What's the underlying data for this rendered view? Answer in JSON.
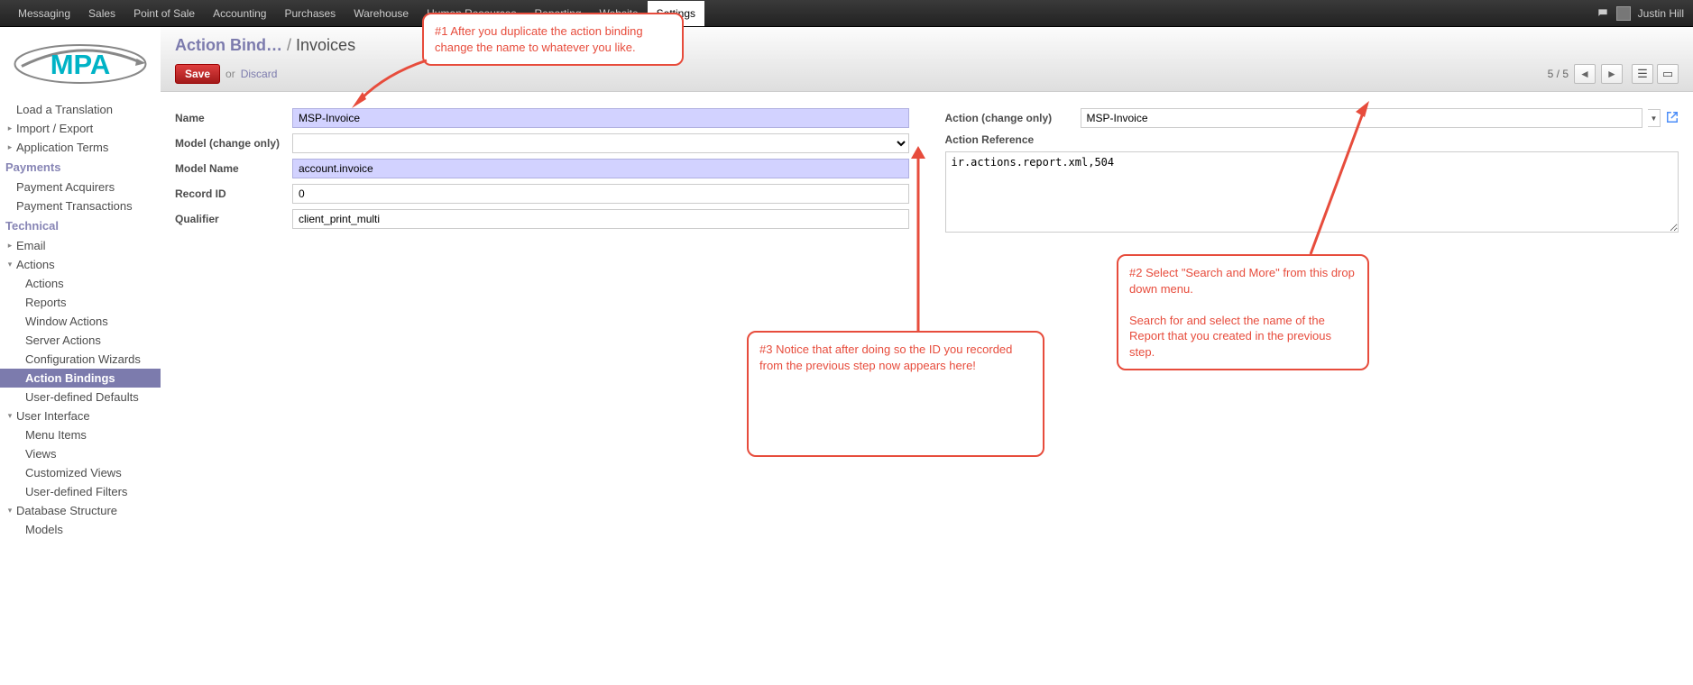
{
  "topmenu": {
    "items": [
      "Messaging",
      "Sales",
      "Point of Sale",
      "Accounting",
      "Purchases",
      "Warehouse",
      "Human Resources",
      "Reporting",
      "Website",
      "Settings"
    ],
    "active_index": 9
  },
  "user": {
    "name": "Justin Hill"
  },
  "breadcrumb": {
    "parent": "Action Bind…",
    "current": "Invoices"
  },
  "toolbar": {
    "save": "Save",
    "or": "or",
    "discard": "Discard"
  },
  "pager": {
    "text": "5 / 5"
  },
  "sidebar": {
    "items_top": [
      {
        "label": "Load a Translation",
        "caret": ""
      },
      {
        "label": "Import / Export",
        "caret": "▸"
      },
      {
        "label": "Application Terms",
        "caret": "▸"
      }
    ],
    "section_payments": "Payments",
    "payments": [
      {
        "label": "Payment Acquirers"
      },
      {
        "label": "Payment Transactions"
      }
    ],
    "section_technical": "Technical",
    "technical": [
      {
        "label": "Email",
        "caret": "▸"
      },
      {
        "label": "Actions",
        "caret": "▾",
        "children": [
          {
            "label": "Actions"
          },
          {
            "label": "Reports"
          },
          {
            "label": "Window Actions"
          },
          {
            "label": "Server Actions"
          },
          {
            "label": "Configuration Wizards"
          },
          {
            "label": "Action Bindings",
            "active": true
          },
          {
            "label": "User-defined Defaults"
          }
        ]
      },
      {
        "label": "User Interface",
        "caret": "▾",
        "children": [
          {
            "label": "Menu Items"
          },
          {
            "label": "Views"
          },
          {
            "label": "Customized Views"
          },
          {
            "label": "User-defined Filters"
          }
        ]
      },
      {
        "label": "Database Structure",
        "caret": "▾",
        "children": [
          {
            "label": "Models"
          }
        ]
      }
    ]
  },
  "form": {
    "left": {
      "name_label": "Name",
      "name_value": "MSP-Invoice",
      "model_label": "Model (change only)",
      "model_value": "",
      "modelname_label": "Model Name",
      "modelname_value": "account.invoice",
      "recordid_label": "Record ID",
      "recordid_value": "0",
      "qualifier_label": "Qualifier",
      "qualifier_value": "client_print_multi"
    },
    "right": {
      "action_label": "Action (change only)",
      "action_value": "MSP-Invoice",
      "actionref_label": "Action Reference",
      "actionref_value": "ir.actions.report.xml,504"
    }
  },
  "callouts": {
    "c1": "#1 After you duplicate the action binding change the name to whatever you like.",
    "c2": "#2 Select \"Search and More\" from this drop down menu.\n\nSearch for and select the name of the Report that you created in the previous step.",
    "c3": "#3 Notice that after doing so the ID you recorded from the previous step now appears here!"
  }
}
